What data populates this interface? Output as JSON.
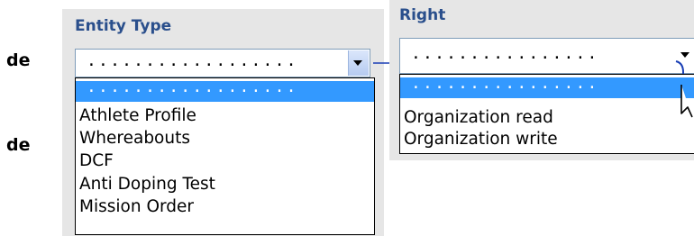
{
  "row_labels": [
    "de",
    "de"
  ],
  "entity_type_panel": {
    "title": "Entity Type",
    "select_value": "..................",
    "options": [
      {
        "label": "..................",
        "selected": true
      },
      {
        "label": "Athlete Profile",
        "selected": false
      },
      {
        "label": "Whereabouts",
        "selected": false
      },
      {
        "label": "DCF",
        "selected": false
      },
      {
        "label": "Anti Doping Test",
        "selected": false
      },
      {
        "label": "Mission Order",
        "selected": false
      }
    ]
  },
  "right_panel": {
    "title": "Right",
    "select_value": "................",
    "options": [
      {
        "label": "................",
        "selected": true
      },
      {
        "label": "Organization read",
        "selected": false
      },
      {
        "label": "Organization write",
        "selected": false
      }
    ]
  },
  "icons": {
    "dropdown": "chevron-down-icon",
    "cursor": "mouse-pointer-icon"
  },
  "colors": {
    "title": "#2a4f8c",
    "selection": "#3399ff",
    "panel_bg": "#e6e6e6",
    "connector": "#1a3fb5"
  }
}
